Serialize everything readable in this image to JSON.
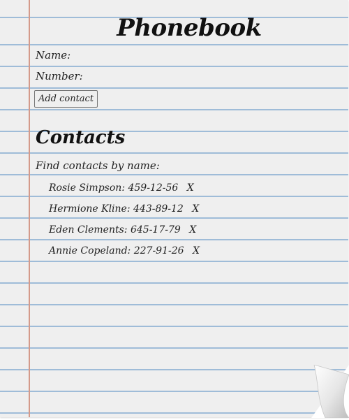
{
  "title": "Phonebook",
  "form": {
    "name_label": "Name:",
    "number_label": "Number:",
    "add_button_label": "Add contact"
  },
  "contacts": {
    "heading": "Contacts",
    "filter_label": "Find contacts by name:",
    "items": [
      {
        "name": "Rosie Simpson",
        "number": "459-12-56",
        "delete_label": "X"
      },
      {
        "name": "Hermione Kline",
        "number": "443-89-12",
        "delete_label": "X"
      },
      {
        "name": "Eden Clements",
        "number": "645-17-79",
        "delete_label": "X"
      },
      {
        "name": "Annie Copeland",
        "number": "227-91-26",
        "delete_label": "X"
      }
    ]
  },
  "colors": {
    "paper": "#efefef",
    "rule_line": "#9fbcd8",
    "margin_line": "#d49a8a"
  }
}
